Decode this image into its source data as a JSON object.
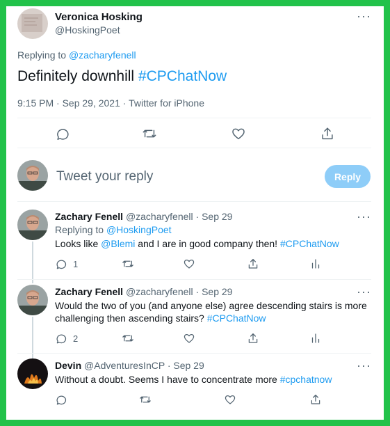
{
  "main_tweet": {
    "author_name": "Veronica Hosking",
    "author_handle": "@HoskingPoet",
    "replying_prefix": "Replying to",
    "replying_to": "@zacharyfenell",
    "text": "Definitely downhill",
    "hashtag": "#CPChatNow",
    "meta": "9:15 PM · Sep 29, 2021 · Twitter for iPhone",
    "more_label": "···"
  },
  "composer": {
    "placeholder": "Tweet your reply",
    "button_label": "Reply"
  },
  "replies": [
    {
      "name": "Zachary Fenell",
      "handle": "@zacharyfenell",
      "date": "· Sep 29",
      "replying_prefix": "Replying to",
      "replying_to": "@HoskingPoet",
      "text_before": "Looks like",
      "mention": "@Blemi",
      "text_after": "and I are in good company then!",
      "hashtag": "#CPChatNow",
      "reply_count": "1"
    },
    {
      "name": "Zachary Fenell",
      "handle": "@zacharyfenell",
      "date": "· Sep 29",
      "line1": "Would the two of you (and anyone else) agree descending stairs is more",
      "line2": "challenging then ascending stairs?",
      "hashtag": "#CPChatNow",
      "reply_count": "2"
    },
    {
      "name": "Devin",
      "handle": "@AdventuresInCP",
      "date": "· Sep 29",
      "text": "Without a doubt. Seems I have to concentrate more",
      "hashtag": "#cpchatnow"
    }
  ],
  "colors": {
    "frame_border": "#22c24a",
    "accent": "#1d9bf0",
    "reply_button_disabled": "#8ecdf8",
    "secondary_text": "#536471"
  }
}
